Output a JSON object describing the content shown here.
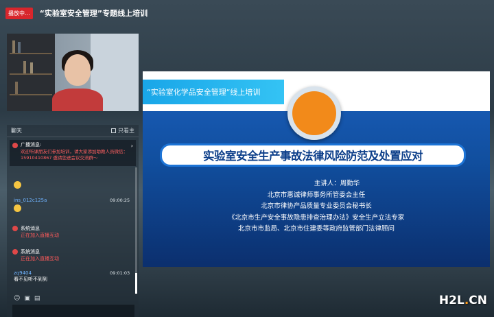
{
  "topbar": {
    "live_badge": "播放中...",
    "title": "“实验室安全管理”专题线上培训"
  },
  "chat": {
    "title": "聊天",
    "host_only": "只看主",
    "notice": {
      "title": "广播消息:",
      "body": "欢迎听课朋友们参加培训，请大家添加助教人员微信：15910410867 邀请您进会议交流群～"
    },
    "messages": [
      {
        "user": "ins_012c125a",
        "time": "09:00:25"
      },
      {
        "sys_label": "系统消息",
        "sys_text": "正在加入直播互动"
      },
      {
        "sys_label": "系统消息",
        "sys_text": "正在加入直播互动"
      },
      {
        "user": "zq9404",
        "time": "09:01:03",
        "text": "看不见听不到到"
      }
    ]
  },
  "slide": {
    "banner": "“实验室化学品安全管理“线上培训",
    "title": "实验室安全生产事故法律风险防范及处置应对",
    "lines": [
      "主讲人：周勤华",
      "北京市惠诚律师事务所管委会主任",
      "北京市律协产品质量专业委员会秘书长",
      "《北京市生产安全事故隐患排查治理办法》安全生产立法专家",
      "北京市市监局、北京市住建委等政府监管部门法律顾问"
    ]
  },
  "watermark": {
    "h2l": "H2L",
    "dot": ".",
    "cn": "CN"
  }
}
